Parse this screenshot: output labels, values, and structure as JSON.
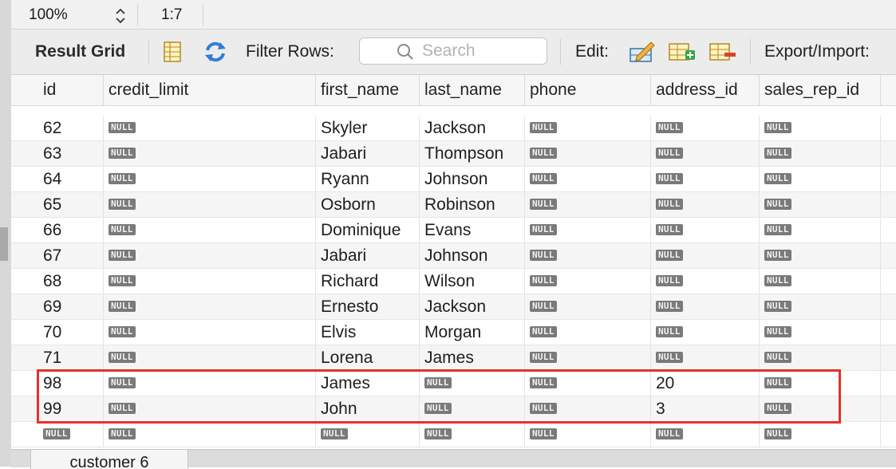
{
  "status": {
    "zoom": "100%",
    "cursor_position": "1:7"
  },
  "toolbar": {
    "title": "Result Grid",
    "filter_label": "Filter Rows:",
    "search_placeholder": "Search",
    "edit_label": "Edit:",
    "export_label": "Export/Import:"
  },
  "grid": {
    "columns": [
      "id",
      "credit_limit",
      "first_name",
      "last_name",
      "phone",
      "address_id",
      "sales_rep_id"
    ],
    "null_label": "NULL",
    "rows": [
      [
        "62",
        null,
        "Skyler",
        "Jackson",
        null,
        null,
        null
      ],
      [
        "63",
        null,
        "Jabari",
        "Thompson",
        null,
        null,
        null
      ],
      [
        "64",
        null,
        "Ryann",
        "Johnson",
        null,
        null,
        null
      ],
      [
        "65",
        null,
        "Osborn",
        "Robinson",
        null,
        null,
        null
      ],
      [
        "66",
        null,
        "Dominique",
        "Evans",
        null,
        null,
        null
      ],
      [
        "67",
        null,
        "Jabari",
        "Johnson",
        null,
        null,
        null
      ],
      [
        "68",
        null,
        "Richard",
        "Wilson",
        null,
        null,
        null
      ],
      [
        "69",
        null,
        "Ernesto",
        "Jackson",
        null,
        null,
        null
      ],
      [
        "70",
        null,
        "Elvis",
        "Morgan",
        null,
        null,
        null
      ],
      [
        "71",
        null,
        "Lorena",
        "James",
        null,
        null,
        null
      ],
      [
        "98",
        null,
        "James",
        null,
        null,
        "20",
        null
      ],
      [
        "99",
        null,
        "John",
        null,
        null,
        "3",
        null
      ],
      [
        null,
        null,
        null,
        null,
        null,
        null,
        null
      ]
    ]
  },
  "tabs": [
    {
      "label": "customer 6"
    }
  ],
  "colors": {
    "highlight": "#e3322b",
    "null_badge": "#7a7a7a"
  },
  "icons": [
    "form-editor-icon",
    "refresh-icon",
    "search-icon",
    "edit-cell-icon",
    "add-row-icon",
    "delete-row-icon"
  ]
}
